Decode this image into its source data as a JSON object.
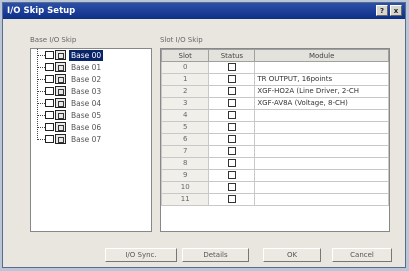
{
  "window": {
    "title": "I/O Skip Setup",
    "help_glyph": "?",
    "close_glyph": "x"
  },
  "base_section": {
    "label": "Base I/O Skip",
    "items": [
      "Base 00",
      "Base 01",
      "Base 02",
      "Base 03",
      "Base 04",
      "Base 05",
      "Base 06",
      "Base 07"
    ],
    "selected": "Base 00"
  },
  "slot_section": {
    "label": "Slot I/O Skip",
    "columns": [
      "Slot",
      "Status",
      "Module"
    ],
    "rows": [
      {
        "slot": "0",
        "module": ""
      },
      {
        "slot": "1",
        "module": "TR OUTPUT, 16points"
      },
      {
        "slot": "2",
        "module": "XGF-HO2A (Line Driver, 2-CH"
      },
      {
        "slot": "3",
        "module": "XGF-AV8A (Voltage, 8-CH)"
      },
      {
        "slot": "4",
        "module": ""
      },
      {
        "slot": "5",
        "module": ""
      },
      {
        "slot": "6",
        "module": ""
      },
      {
        "slot": "7",
        "module": ""
      },
      {
        "slot": "8",
        "module": ""
      },
      {
        "slot": "9",
        "module": ""
      },
      {
        "slot": "10",
        "module": ""
      },
      {
        "slot": "11",
        "module": ""
      }
    ]
  },
  "buttons": {
    "io_sync": "I/O Sync.",
    "details": "Details",
    "ok": "OK",
    "cancel": "Cancel"
  }
}
